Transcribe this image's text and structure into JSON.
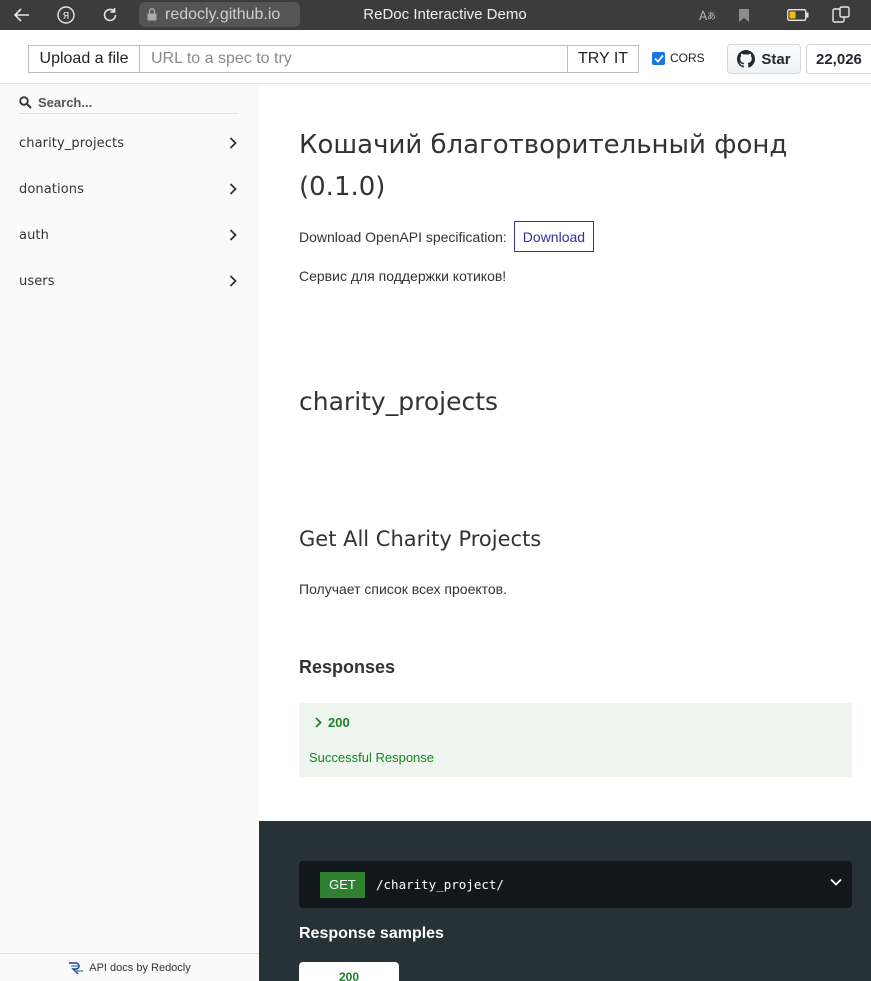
{
  "browser": {
    "url": "redocly.github.io",
    "title": "ReDoc Interactive Demo"
  },
  "toolbar": {
    "upload_label": "Upload a file",
    "url_placeholder": "URL to a spec to try",
    "try_label": "TRY IT",
    "cors_label": "CORS",
    "cors_checked": true,
    "star_label": "Star",
    "star_count": "22,026"
  },
  "sidebar": {
    "search_placeholder": "Search...",
    "items": [
      {
        "label": "charity_projects"
      },
      {
        "label": "donations"
      },
      {
        "label": "auth"
      },
      {
        "label": "users"
      }
    ],
    "footer": "API docs by Redocly"
  },
  "main": {
    "api_title": "Кошачий благотворительный фонд (0.1.0)",
    "download_text": "Download OpenAPI specification:",
    "download_button": "Download",
    "description": "Сервис для поддержки котиков!",
    "tag_title": "charity_projects",
    "operation_title": "Get All Charity Projects",
    "operation_desc": "Получает список всех проектов.",
    "responses_title": "Responses",
    "response": {
      "code": "200",
      "description": "Successful Response"
    }
  },
  "panel": {
    "method": "GET",
    "path": "/charity_project/",
    "samples_title": "Response samples",
    "sample_tab": "200"
  },
  "colors": {
    "accent": "#32329f",
    "success": "#1d8127",
    "dark_panel": "#263238",
    "get_method": "#2f8132"
  }
}
